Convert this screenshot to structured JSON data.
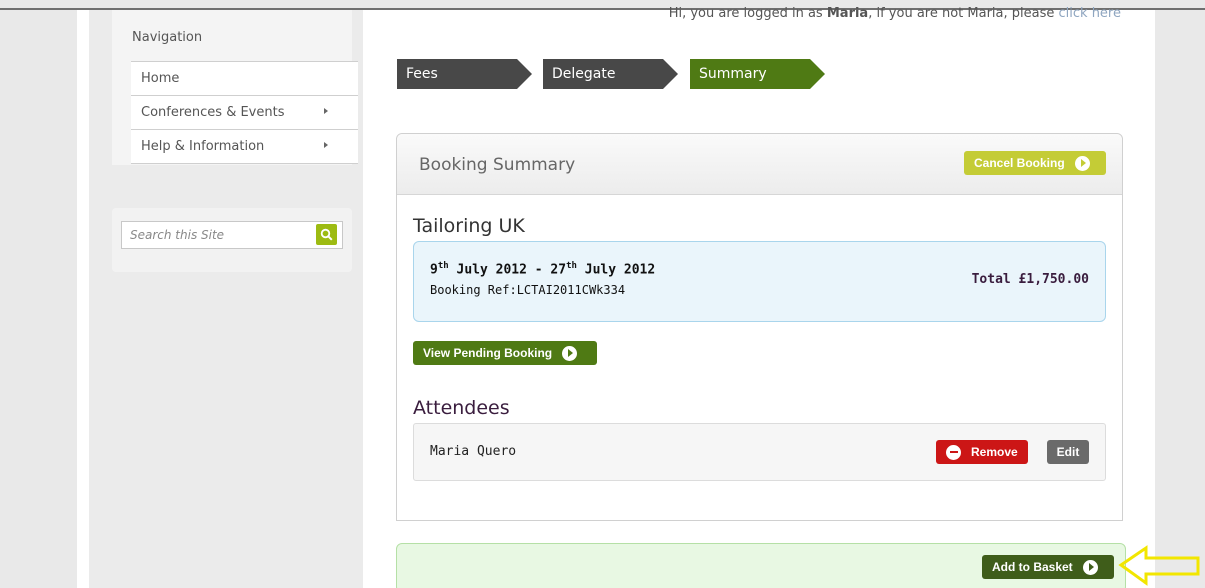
{
  "greeting": {
    "prefix": "Hi, you are logged in as",
    "user": "Maria",
    "middle": ", if you are not Maria, please",
    "link": "click here"
  },
  "sidebar": {
    "nav_title": "Navigation",
    "items": [
      {
        "label": "Home",
        "has_arrow": false
      },
      {
        "label": "Conferences & Events",
        "has_arrow": true
      },
      {
        "label": "Help & Information",
        "has_arrow": true
      }
    ],
    "search": {
      "placeholder": "Search this Site",
      "icon": "search-icon"
    }
  },
  "steps": [
    {
      "label": "Fees",
      "state": "done"
    },
    {
      "label": "Delegate",
      "state": "done"
    },
    {
      "label": "Summary",
      "state": "active"
    }
  ],
  "booking": {
    "panel_title": "Booking Summary",
    "cancel_label": "Cancel Booking",
    "event_title": "Tailoring UK",
    "date_start_day": "9",
    "date_start_suffix": "th",
    "date_start_rest": " July 2012 - ",
    "date_end_day": "27",
    "date_end_suffix": "th",
    "date_end_rest": " July 2012",
    "ref": "Booking Ref:LCTAI2011CWk334",
    "total": "Total £1,750.00",
    "pending_label": "View Pending Booking"
  },
  "attendees": {
    "title": "Attendees",
    "rows": [
      {
        "name": "Maria Quero",
        "remove_label": "Remove",
        "edit_label": "Edit"
      }
    ]
  },
  "basket": {
    "label": "Add to Basket"
  },
  "colors": {
    "step_done": "#484848",
    "step_active": "#4f7a14",
    "cancel": "#c4cc36",
    "remove": "#cc1616",
    "basket": "#3f5d1a",
    "annotation_arrow": "#f2e600"
  }
}
